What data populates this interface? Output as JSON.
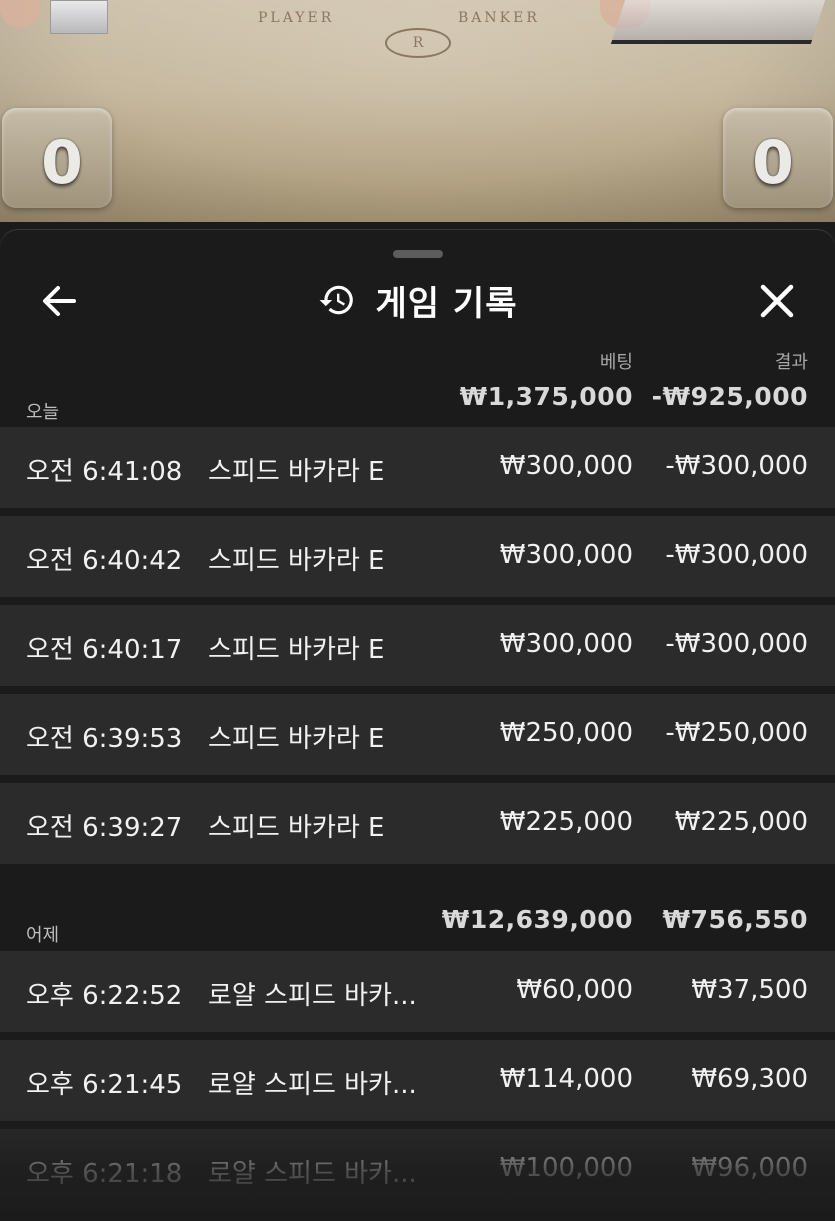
{
  "table": {
    "player_label": "PLAYER",
    "banker_label": "BANKER",
    "crest_letter": "R",
    "player_score": "0",
    "banker_score": "0"
  },
  "header": {
    "title": "게임 기록",
    "back_icon": "arrow-left-icon",
    "history_icon": "history-icon",
    "close_icon": "close-icon"
  },
  "columns": {
    "bet": "베팅",
    "result": "결과"
  },
  "sections": [
    {
      "label": "오늘",
      "bet_total": "₩1,375,000",
      "result_total": "-₩925,000",
      "rows": [
        {
          "time": "오전 6:41:08",
          "game": "스피드 바카라 E",
          "bet": "₩300,000",
          "result": "-₩300,000"
        },
        {
          "time": "오전 6:40:42",
          "game": "스피드 바카라 E",
          "bet": "₩300,000",
          "result": "-₩300,000"
        },
        {
          "time": "오전 6:40:17",
          "game": "스피드 바카라 E",
          "bet": "₩300,000",
          "result": "-₩300,000"
        },
        {
          "time": "오전 6:39:53",
          "game": "스피드 바카라 E",
          "bet": "₩250,000",
          "result": "-₩250,000"
        },
        {
          "time": "오전 6:39:27",
          "game": "스피드 바카라 E",
          "bet": "₩225,000",
          "result": "₩225,000"
        }
      ]
    },
    {
      "label": "어제",
      "bet_total": "₩12,639,000",
      "result_total": "₩756,550",
      "rows": [
        {
          "time": "오후 6:22:52",
          "game": "로얄 스피드 바카...",
          "bet": "₩60,000",
          "result": "₩37,500"
        },
        {
          "time": "오후 6:21:45",
          "game": "로얄 스피드 바카...",
          "bet": "₩114,000",
          "result": "₩69,300"
        },
        {
          "time": "오후 6:21:18",
          "game": "로얄 스피드 바카...",
          "bet": "₩100,000",
          "result": "₩96,000"
        }
      ]
    }
  ],
  "colors": {
    "sheet_bg": "#1b1b1b",
    "row_bg": "#2b2b2b",
    "text": "#f1f1f1",
    "muted": "#a7a7a7"
  }
}
